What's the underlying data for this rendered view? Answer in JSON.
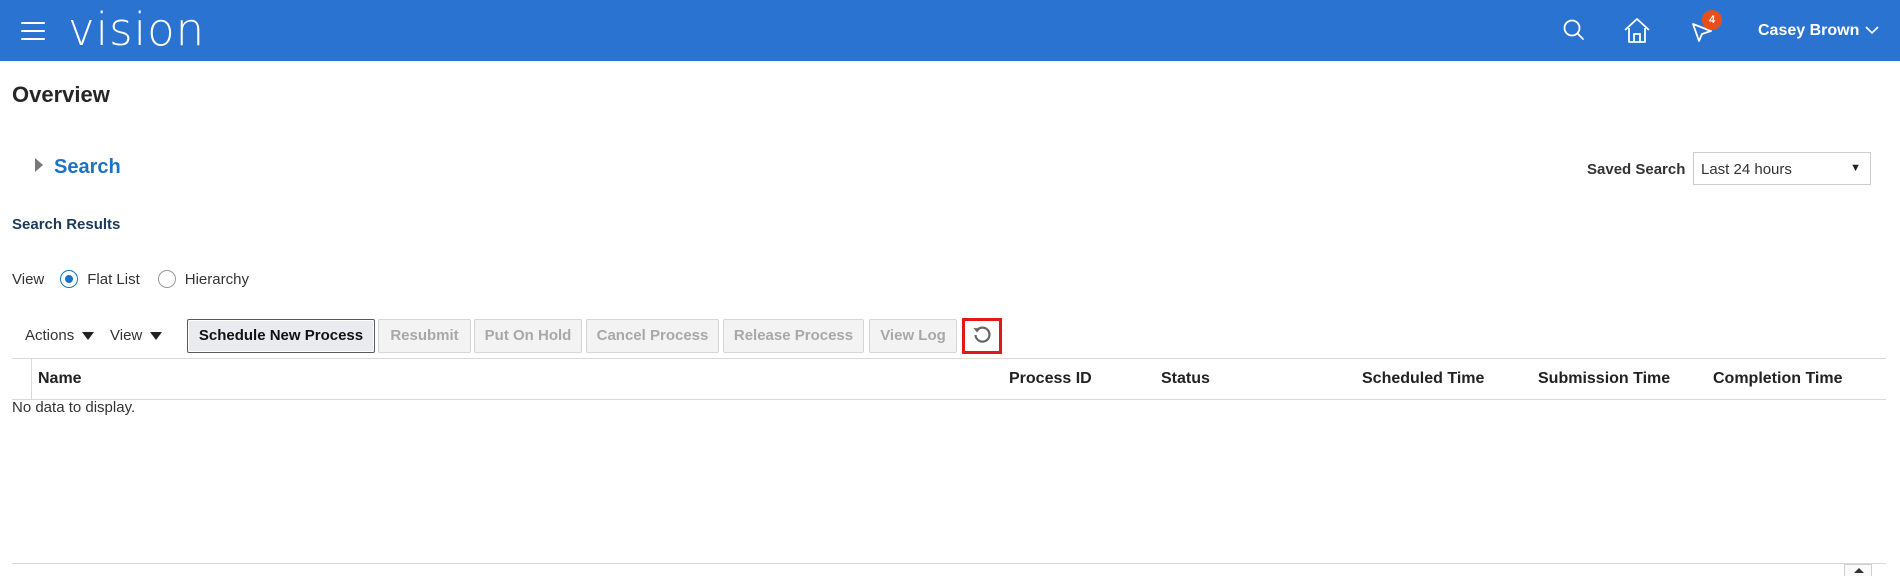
{
  "header": {
    "app_name": "vision",
    "menu_icon": "hamburger-menu-icon",
    "search_icon": "search-icon",
    "home_icon": "home-icon",
    "notifications_icon": "notifications-icon",
    "notification_count": "4",
    "user_name": "Casey Brown",
    "bar_color": "#2b73d1",
    "badge_color": "#e8501b"
  },
  "page": {
    "title": "Overview"
  },
  "search": {
    "label": "Search",
    "expanded": false,
    "saved_search_label": "Saved Search",
    "saved_search_value": "Last 24 hours"
  },
  "results": {
    "title": "Search Results",
    "view_label": "View",
    "view_options": [
      {
        "label": "Flat List",
        "selected": true
      },
      {
        "label": "Hierarchy",
        "selected": false
      }
    ]
  },
  "toolbar": {
    "actions_label": "Actions",
    "view_menu_label": "View",
    "buttons": [
      {
        "label": "Schedule New Process",
        "enabled": true
      },
      {
        "label": "Resubmit",
        "enabled": false
      },
      {
        "label": "Put On Hold",
        "enabled": false
      },
      {
        "label": "Cancel Process",
        "enabled": false
      },
      {
        "label": "Release Process",
        "enabled": false
      },
      {
        "label": "View Log",
        "enabled": false
      }
    ],
    "refresh_icon": "refresh-icon",
    "highlight_color": "#e31818"
  },
  "table": {
    "columns": [
      "Name",
      "Process ID",
      "Status",
      "Scheduled Time",
      "Submission Time",
      "Completion Time"
    ],
    "rows": [],
    "empty_message": "No data to display."
  }
}
